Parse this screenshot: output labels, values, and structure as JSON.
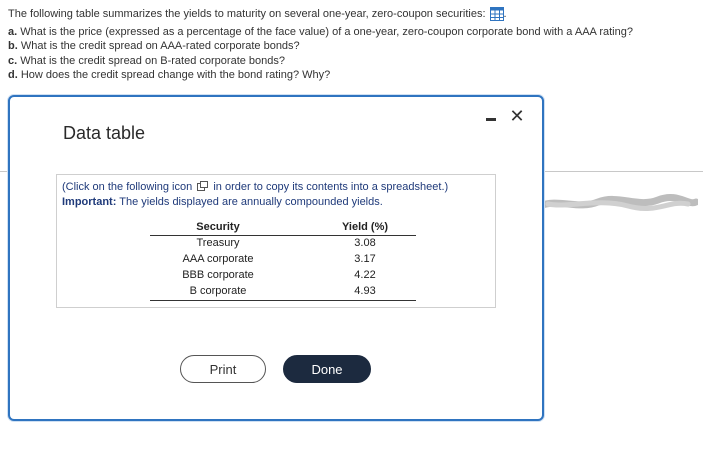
{
  "question": {
    "intro": "The following table summarizes the yields to maturity on several one-year, zero-coupon securities:",
    "intro_end": ".",
    "a_label": "a.",
    "a_text": "What is the price (expressed as a percentage of the face value) of a one-year, zero-coupon corporate bond with a AAA rating?",
    "b_label": "b.",
    "b_text": "What is the credit spread on AAA-rated corporate bonds?",
    "c_label": "c.",
    "c_text": "What is the credit spread on B-rated corporate bonds?",
    "d_label": "d.",
    "d_text": "How does the credit spread change with the bond rating? Why?"
  },
  "dialog": {
    "title": "Data table",
    "note_prefix": "(Click on the following icon",
    "note_suffix": "in order to copy its contents into a spreadsheet.)",
    "important_label": "Important:",
    "important_text": "The yields displayed are annually compounded yields.",
    "table": {
      "headers": [
        "Security",
        "Yield (%)"
      ],
      "rows": [
        [
          "Treasury",
          "3.08"
        ],
        [
          "AAA corporate",
          "3.17"
        ],
        [
          "BBB corporate",
          "4.22"
        ],
        [
          "B corporate",
          "4.93"
        ]
      ]
    },
    "print_label": "Print",
    "done_label": "Done"
  },
  "colors": {
    "dialog_border": "#2f74c0",
    "note_text": "#1f3a7a",
    "done_bg": "#1c2a3f"
  },
  "icons": [
    "spreadsheet-icon",
    "copy-icon",
    "minimize-icon",
    "close-icon"
  ]
}
